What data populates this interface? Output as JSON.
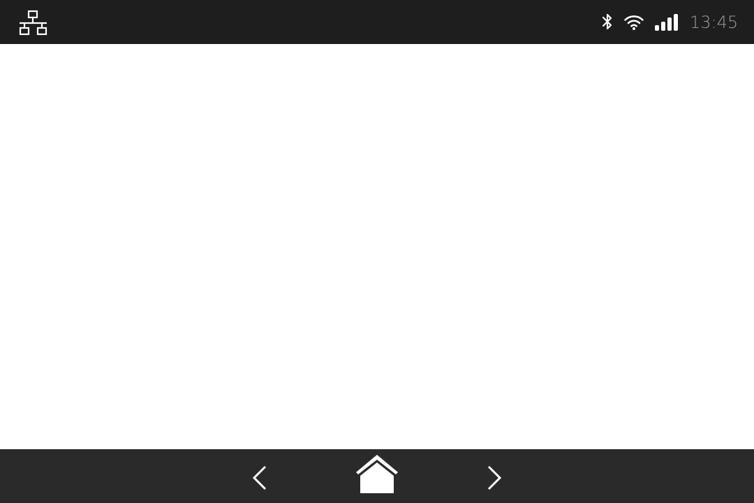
{
  "status_bar": {
    "left_icon": "network-topology-icon",
    "icons": [
      "bluetooth-icon",
      "wifi-icon",
      "cellular-signal-icon"
    ],
    "clock": "13:45",
    "background_color": "#1e1e1e",
    "icon_color": "#ffffff",
    "clock_color": "#9a9a9a"
  },
  "content": {
    "background_color": "#ffffff"
  },
  "nav_bar": {
    "buttons": [
      "back-icon",
      "home-icon",
      "forward-icon"
    ],
    "background_color": "#2a2a2a"
  }
}
